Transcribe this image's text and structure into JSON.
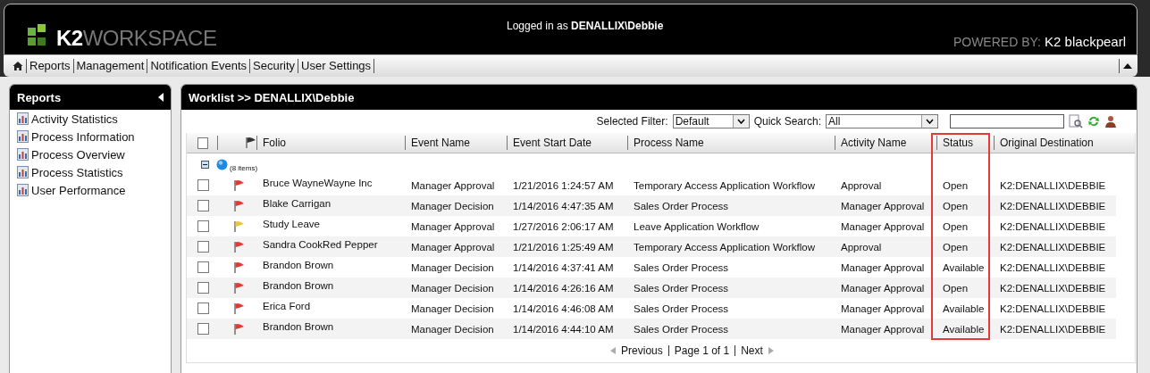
{
  "header": {
    "logo_prefix": "K2",
    "logo_suffix": "WORKSPACE",
    "login_label": "Logged in as ",
    "login_user": "DENALLIX\\Debbie",
    "powered_by": "POWERED BY:",
    "powered_brand": "K2 blackpearl"
  },
  "nav": {
    "items": [
      "Reports",
      "Management",
      "Notification Events",
      "Security",
      "User Settings"
    ]
  },
  "sidebar": {
    "title": "Reports",
    "items": [
      "Activity Statistics",
      "Process Information",
      "Process Overview",
      "Process Statistics",
      "User Performance"
    ]
  },
  "worklist": {
    "title": "Worklist >> DENALLIX\\Debbie",
    "filter": {
      "label": "Selected Filter:",
      "value": "Default"
    },
    "quick_search": {
      "label": "Quick Search:",
      "value": "All"
    },
    "table": {
      "select_all_checked": false,
      "columns": [
        {
          "label": "Folio",
          "highlighted": false
        },
        {
          "label": "Event Name",
          "highlighted": false
        },
        {
          "label": "Event Start Date",
          "highlighted": false
        },
        {
          "label": "Process Name",
          "highlighted": false
        },
        {
          "label": "Activity Name",
          "highlighted": false
        },
        {
          "label": "Status",
          "highlighted": true
        },
        {
          "label": "Original Destination",
          "highlighted": false
        }
      ],
      "group": {
        "expanded": true,
        "count": "(8 items)"
      },
      "rows": [
        {
          "checked": false,
          "color": "#e53935",
          "cells": [
            "Bruce WayneWayne Inc",
            "Manager Approval",
            "1/21/2016 1:24:57 AM",
            "Temporary Access Application Workflow",
            "Approval",
            "Open",
            "K2:DENALLIX\\DEBBIE"
          ]
        },
        {
          "checked": false,
          "color": "#e53935",
          "cells": [
            "Blake Carrigan",
            "Manager Decision",
            "1/14/2016 4:47:35 AM",
            "Sales Order Process",
            "Manager Approval",
            "Open",
            "K2:DENALLIX\\DEBBIE"
          ]
        },
        {
          "checked": false,
          "color": "#e8c840",
          "cells": [
            "Study Leave",
            "Manager Approval",
            "1/27/2016 2:06:17 AM",
            "Leave Application Workflow",
            "Manager Approval",
            "Open",
            "K2:DENALLIX\\DEBBIE"
          ]
        },
        {
          "checked": false,
          "color": "#e53935",
          "cells": [
            "Sandra CookRed Pepper",
            "Manager Approval",
            "1/21/2016 1:25:49 AM",
            "Temporary Access Application Workflow",
            "Approval",
            "Open",
            "K2:DENALLIX\\DEBBIE"
          ]
        },
        {
          "checked": false,
          "color": "#e53935",
          "cells": [
            "Brandon Brown",
            "Manager Decision",
            "1/14/2016 4:37:41 AM",
            "Sales Order Process",
            "Manager Approval",
            "Available",
            "K2:DENALLIX\\DEBBIE"
          ]
        },
        {
          "checked": false,
          "color": "#e53935",
          "cells": [
            "Brandon Brown",
            "Manager Decision",
            "1/14/2016 4:26:16 AM",
            "Sales Order Process",
            "Manager Approval",
            "Open",
            "K2:DENALLIX\\DEBBIE"
          ]
        },
        {
          "checked": false,
          "color": "#e53935",
          "cells": [
            "Erica Ford",
            "Manager Decision",
            "1/14/2016 4:46:08 AM",
            "Sales Order Process",
            "Manager Approval",
            "Available",
            "K2:DENALLIX\\DEBBIE"
          ]
        },
        {
          "checked": false,
          "color": "#e53935",
          "cells": [
            "Brandon Brown",
            "Manager Decision",
            "1/14/2016 4:44:10 AM",
            "Sales Order Process",
            "Manager Approval",
            "Available",
            "K2:DENALLIX\\DEBBIE"
          ]
        }
      ]
    },
    "pagination": {
      "previous": "Previous",
      "page": "Page 1 of 1",
      "next": "Next"
    }
  }
}
